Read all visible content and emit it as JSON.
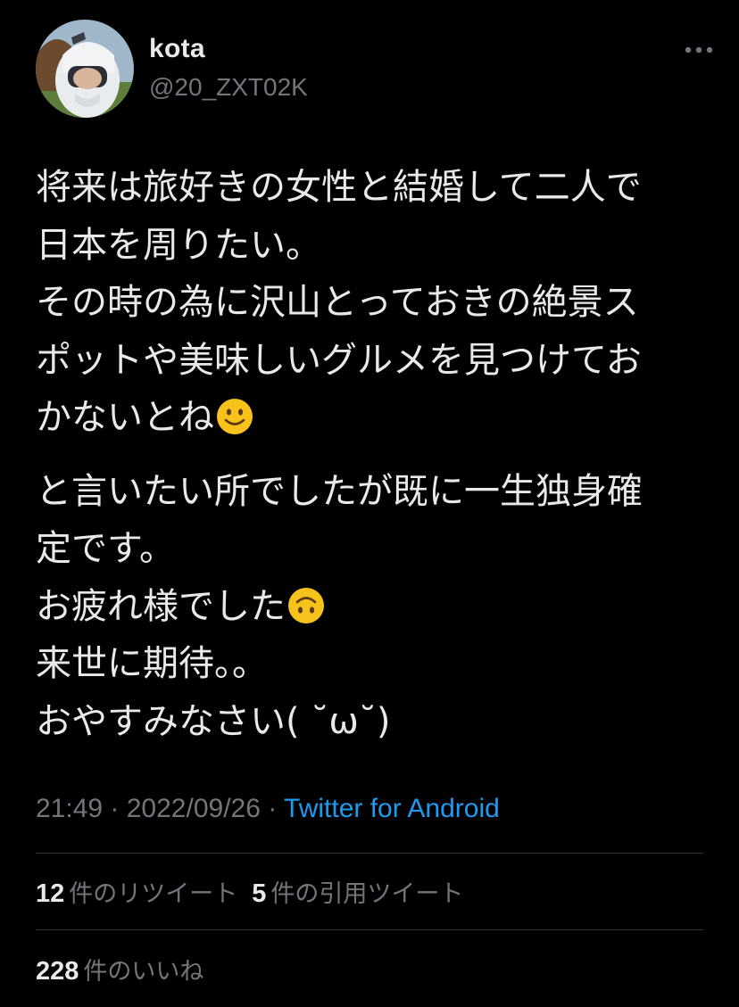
{
  "author": {
    "name": "kota",
    "handle": "@20_ZXT02K"
  },
  "tweet": {
    "paragraph1": [
      "将来は旅好きの女性と結婚して二人で",
      "日本を周りたい。",
      "その時の為に沢山とっておきの絶景ス",
      "ポットや美味しいグルメを見つけてお",
      "かないとね"
    ],
    "paragraph2": [
      "と言いたい所でしたが既に一生独身確",
      "定です。",
      "お疲れ様でした",
      "来世に期待。。",
      "おやすみなさい( ˘ω˘)"
    ],
    "emojis": [
      "slightly-smiling-face",
      "upside-down-face"
    ]
  },
  "meta": {
    "time": "21:49",
    "separator": " · ",
    "date": "2022/09/26",
    "source": "Twitter for Android"
  },
  "stats": {
    "retweets": {
      "count": "12",
      "label": "件のリツイート"
    },
    "quotes": {
      "count": "5",
      "label": "件の引用ツイート"
    },
    "likes": {
      "count": "228",
      "label": "件のいいね"
    }
  },
  "colors": {
    "background": "#000000",
    "text": "#e7e9ea",
    "secondary": "#71767b",
    "link": "#1d9bf0",
    "divider": "#2f3336",
    "emoji": "#f7c21b"
  }
}
